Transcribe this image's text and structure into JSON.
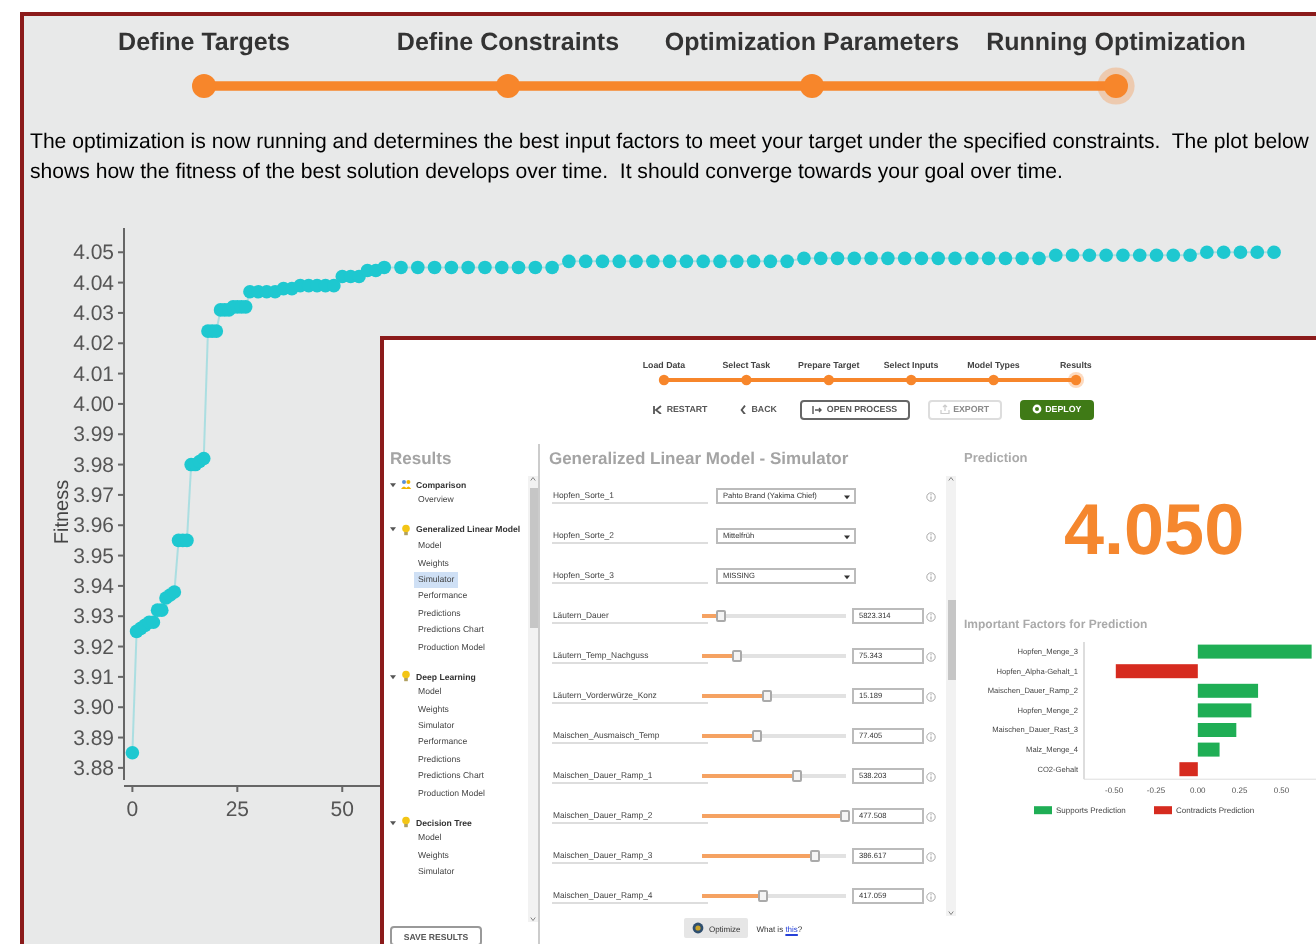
{
  "steps": [
    {
      "label": "Define Targets",
      "current": false
    },
    {
      "label": "Define Constraints",
      "current": false
    },
    {
      "label": "Optimization Parameters",
      "current": false
    },
    {
      "label": "Running Optimization",
      "current": true
    }
  ],
  "description": "The optimization is now running and determines the best input factors to meet your target under the specified constraints.  The plot below shows how the fitness of the best solution develops over time.  It should converge towards your goal over time.",
  "fitness_chart": {
    "chart_data": {
      "type": "line",
      "ylabel": "Fitness",
      "x": [
        0,
        1,
        2,
        3,
        4,
        5,
        6,
        7,
        8,
        9,
        10,
        11,
        12,
        13,
        14,
        15,
        16,
        17,
        18,
        19,
        20,
        21,
        22,
        23,
        24,
        25,
        26,
        27,
        28,
        30,
        32,
        34,
        36,
        38,
        40,
        42,
        44,
        46,
        48,
        50,
        52,
        54,
        56,
        58,
        60,
        64,
        68,
        72,
        76,
        80,
        84,
        88,
        92,
        96,
        100,
        104,
        108,
        112,
        116,
        120,
        124,
        128,
        132,
        136,
        140,
        144,
        148,
        152,
        156,
        160,
        164,
        168,
        172,
        176,
        180,
        184,
        188,
        192,
        196,
        200,
        204,
        208,
        212,
        216,
        220,
        224,
        228,
        232,
        236,
        240,
        244,
        248,
        252,
        256,
        260,
        264,
        268,
        272
      ],
      "xlim": [
        -2,
        282
      ],
      "ylim": [
        3.876,
        4.058
      ],
      "series": [
        {
          "color": "#1ec8d0",
          "marker": "circle",
          "values": [
            3.885,
            3.925,
            3.926,
            3.927,
            3.928,
            3.928,
            3.932,
            3.932,
            3.936,
            3.937,
            3.938,
            3.955,
            3.955,
            3.955,
            3.98,
            3.98,
            3.981,
            3.982,
            4.024,
            4.024,
            4.024,
            4.031,
            4.031,
            4.031,
            4.032,
            4.032,
            4.032,
            4.032,
            4.037,
            4.037,
            4.037,
            4.037,
            4.038,
            4.038,
            4.039,
            4.039,
            4.039,
            4.039,
            4.039,
            4.042,
            4.042,
            4.042,
            4.044,
            4.044,
            4.045,
            4.045,
            4.045,
            4.045,
            4.045,
            4.045,
            4.045,
            4.045,
            4.045,
            4.045,
            4.045,
            4.047,
            4.047,
            4.047,
            4.047,
            4.047,
            4.047,
            4.047,
            4.047,
            4.047,
            4.047,
            4.047,
            4.047,
            4.047,
            4.047,
            4.048,
            4.048,
            4.048,
            4.048,
            4.048,
            4.048,
            4.048,
            4.048,
            4.048,
            4.048,
            4.048,
            4.048,
            4.048,
            4.048,
            4.048,
            4.049,
            4.049,
            4.049,
            4.049,
            4.049,
            4.049,
            4.049,
            4.049,
            4.049,
            4.05,
            4.05,
            4.05,
            4.05,
            4.05
          ]
        }
      ],
      "xticks": [
        {
          "value": 0,
          "label": "0"
        },
        {
          "value": 25,
          "label": "25"
        },
        {
          "value": 50,
          "label": "50"
        }
      ],
      "yticks": [
        {
          "value": 3.88,
          "label": "3.88"
        },
        {
          "value": 3.89,
          "label": "3.89"
        },
        {
          "value": 3.9,
          "label": "3.90"
        },
        {
          "value": 3.91,
          "label": "3.91"
        },
        {
          "value": 3.92,
          "label": "3.92"
        },
        {
          "value": 3.93,
          "label": "3.93"
        },
        {
          "value": 3.94,
          "label": "3.94"
        },
        {
          "value": 3.95,
          "label": "3.95"
        },
        {
          "value": 3.96,
          "label": "3.96"
        },
        {
          "value": 3.97,
          "label": "3.97"
        },
        {
          "value": 3.98,
          "label": "3.98"
        },
        {
          "value": 3.99,
          "label": "3.99"
        },
        {
          "value": 4.0,
          "label": "4.00"
        },
        {
          "value": 4.01,
          "label": "4.01"
        },
        {
          "value": 4.02,
          "label": "4.02"
        },
        {
          "value": 4.03,
          "label": "4.03"
        },
        {
          "value": 4.04,
          "label": "4.04"
        },
        {
          "value": 4.05,
          "label": "4.05"
        }
      ]
    }
  },
  "inner_window": {
    "steps": [
      {
        "label": "Load Data",
        "current": false
      },
      {
        "label": "Select Task",
        "current": false
      },
      {
        "label": "Prepare Target",
        "current": false
      },
      {
        "label": "Select Inputs",
        "current": false
      },
      {
        "label": "Model Types",
        "current": false
      },
      {
        "label": "Results",
        "current": true
      }
    ],
    "buttons": [
      {
        "kind": "restart",
        "label": "RESTART",
        "disabled": false
      },
      {
        "kind": "back",
        "label": "BACK",
        "disabled": false
      },
      {
        "kind": "open",
        "label": "OPEN PROCESS",
        "disabled": false
      },
      {
        "kind": "export",
        "label": "EXPORT",
        "disabled": true
      },
      {
        "kind": "deploy",
        "label": "DEPLOY",
        "disabled": false
      }
    ],
    "sidebar": {
      "title": "Results",
      "groups": [
        {
          "kind": "comparison",
          "label": "Comparison",
          "expanded": true,
          "children": [
            {
              "label": "Overview",
              "selected": false
            }
          ]
        },
        {
          "kind": "model",
          "label": "Generalized Linear Model",
          "expanded": true,
          "children": [
            {
              "label": "Model",
              "selected": false
            },
            {
              "label": "Weights",
              "selected": false
            },
            {
              "label": "Simulator",
              "selected": true
            },
            {
              "label": "Performance",
              "selected": false
            },
            {
              "label": "Predictions",
              "selected": false
            },
            {
              "label": "Predictions Chart",
              "selected": false
            },
            {
              "label": "Production Model",
              "selected": false
            }
          ]
        },
        {
          "kind": "model",
          "label": "Deep Learning",
          "expanded": true,
          "children": [
            {
              "label": "Model",
              "selected": false
            },
            {
              "label": "Weights",
              "selected": false
            },
            {
              "label": "Simulator",
              "selected": false
            },
            {
              "label": "Performance",
              "selected": false
            },
            {
              "label": "Predictions",
              "selected": false
            },
            {
              "label": "Predictions Chart",
              "selected": false
            },
            {
              "label": "Production Model",
              "selected": false
            }
          ]
        },
        {
          "kind": "model",
          "label": "Decision Tree",
          "expanded": true,
          "children": [
            {
              "label": "Model",
              "selected": false
            },
            {
              "label": "Weights",
              "selected": false
            },
            {
              "label": "Simulator",
              "selected": false
            }
          ]
        }
      ],
      "save_button": "SAVE RESULTS"
    },
    "simulator": {
      "title": "Generalized Linear Model - Simulator",
      "rows": [
        {
          "kind": "dropdown",
          "label": "Hopfen_Sorte_1",
          "value": "Pahto Brand (Yakima Chief)"
        },
        {
          "kind": "dropdown",
          "label": "Hopfen_Sorte_2",
          "value": "Mittelfrüh"
        },
        {
          "kind": "dropdown",
          "label": "Hopfen_Sorte_3",
          "value": "MISSING"
        },
        {
          "kind": "slider",
          "label": "Läutern_Dauer",
          "level": 0.12,
          "value": "5823.314"
        },
        {
          "kind": "slider",
          "label": "Läutern_Temp_Nachguss",
          "level": 0.24,
          "value": "75.343"
        },
        {
          "kind": "slider",
          "label": "Läutern_Vorderwürze_Konz",
          "level": 0.44,
          "value": "15.189"
        },
        {
          "kind": "slider",
          "label": "Maischen_Ausmaisch_Temp",
          "level": 0.38,
          "value": "77.405"
        },
        {
          "kind": "slider",
          "label": "Maischen_Dauer_Ramp_1",
          "level": 0.65,
          "value": "538.203"
        },
        {
          "kind": "slider",
          "label": "Maischen_Dauer_Ramp_2",
          "level": 0.98,
          "value": "477.508"
        },
        {
          "kind": "slider",
          "label": "Maischen_Dauer_Ramp_3",
          "level": 0.78,
          "value": "386.617"
        },
        {
          "kind": "slider",
          "label": "Maischen_Dauer_Ramp_4",
          "level": 0.42,
          "value": "417.059"
        }
      ],
      "optimize_button": "Optimize",
      "help": {
        "before": "What is",
        "link": "this",
        "after": "?"
      }
    },
    "prediction": {
      "title": "Prediction",
      "value": "4.050",
      "factors_title": "Important Factors for Prediction",
      "chart_data": {
        "type": "bar",
        "orientation": "horizontal",
        "stacked": true,
        "xlim": [
          -0.68,
          0.73
        ],
        "legend": "bottom",
        "categories": [
          "Hopfen_Menge_3",
          "Hopfen_Alpha-Gehalt_1",
          "Maischen_Dauer_Ramp_2",
          "Hopfen_Menge_2",
          "Maischen_Dauer_Rast_3",
          "Malz_Menge_4",
          "CO2-Gehalt"
        ],
        "series": [
          {
            "name": "Supports Prediction",
            "color": "#1fae55",
            "values": [
              0.68,
              null,
              0.36,
              0.32,
              0.23,
              0.13,
              null
            ]
          },
          {
            "name": "Contradicts Prediction",
            "color": "#d62b1f",
            "values": [
              null,
              -0.49,
              null,
              null,
              null,
              null,
              -0.11
            ]
          }
        ],
        "xticks": [
          {
            "value": -0.5,
            "label": "-0.50"
          },
          {
            "value": -0.25,
            "label": "-0.25"
          },
          {
            "value": 0,
            "label": "0.00"
          },
          {
            "value": 0.25,
            "label": "0.25"
          },
          {
            "value": 0.5,
            "label": "0.50"
          }
        ]
      }
    }
  }
}
